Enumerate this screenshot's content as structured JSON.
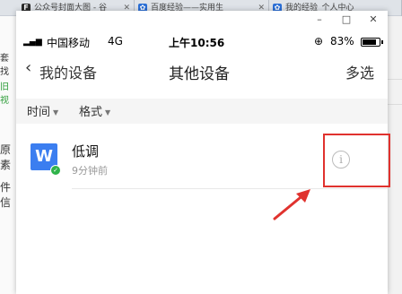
{
  "browser_tabs": [
    {
      "label": "公众号封面大图 - 谷",
      "icon_char": "F",
      "icon_color": "#2a2a2a"
    },
    {
      "label": "百度经验——实用生",
      "icon_char": "✿",
      "icon_color": "#2b6fd6"
    },
    {
      "label": "我的经验_个人中心",
      "icon_char": "✿",
      "icon_color": "#2b6fd6"
    }
  ],
  "background_page": {
    "fragments": [
      "套找",
      "旧视",
      "原素",
      "件信"
    ]
  },
  "window_controls": {
    "minimize": "–",
    "maximize": "□",
    "close": "✕"
  },
  "status_bar": {
    "signal": "▂▄▆",
    "carrier": "中国移动",
    "network": "4G",
    "time": "上午10:56",
    "lock_icon": "⊕",
    "battery_percent": "83%",
    "battery_level": 0.83
  },
  "nav": {
    "back_icon": "‹",
    "back_label": "我的设备",
    "title": "其他设备",
    "multi_select": "多选"
  },
  "filters": [
    {
      "label": "时间"
    },
    {
      "label": "格式"
    }
  ],
  "files": [
    {
      "icon_letter": "W",
      "name": "低调",
      "time": "9分钟前",
      "info_icon": "i"
    }
  ],
  "colors": {
    "word_blue": "#3b7ef0",
    "sync_green": "#2fb34a",
    "highlight_red": "#e0322e"
  }
}
